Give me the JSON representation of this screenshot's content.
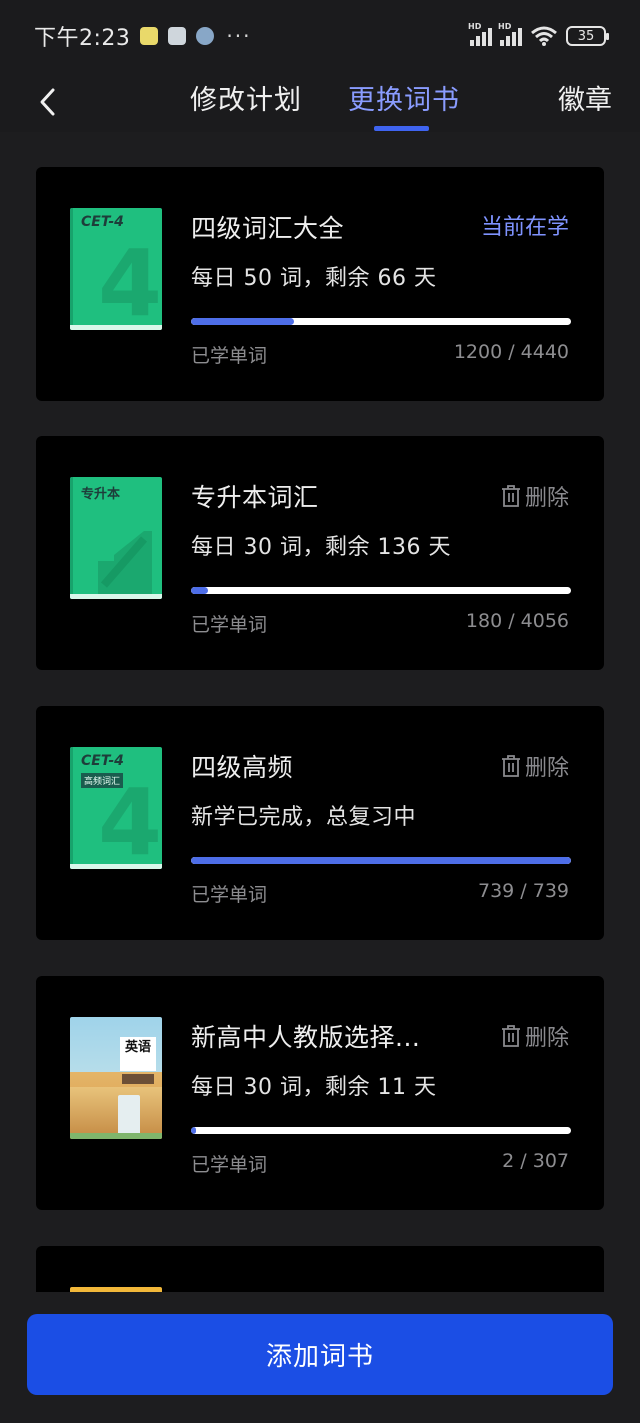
{
  "status_bar": {
    "time": "下午2:23",
    "overflow": "···",
    "signal_1_label": "HD",
    "signal_2_label": "HD",
    "battery": "35",
    "app_icons": [
      "notification-icon",
      "app-icon",
      "app-icon"
    ]
  },
  "nav": {
    "tab_plan": "修改计划",
    "tab_books": "更换词书",
    "tab_badges": "徽章",
    "active_tab": "更换词书",
    "accent_color": "#3f64f0"
  },
  "books": [
    {
      "title": "四级词汇大全",
      "plan": "每日 50 词，剩余 66 天",
      "status": "当前在学",
      "learned_label": "已学单词",
      "learned": "1200 / 4440",
      "progress": 0.27,
      "cover_label": "CET-4",
      "cover_big": "4"
    },
    {
      "title": "专升本词汇",
      "plan": "每日 30 词，剩余 136 天",
      "action": "删除",
      "learned_label": "已学单词",
      "learned": "180 / 4056",
      "progress": 0.044,
      "cover_label": "专升本"
    },
    {
      "title": "四级高频",
      "plan": "新学已完成，总复习中",
      "action": "删除",
      "learned_label": "已学单词",
      "learned": "739 / 739",
      "progress": 1.0,
      "cover_label": "CET-4",
      "cover_sublabel": "高频词汇",
      "cover_big": "4"
    },
    {
      "title": "新高中人教版选择...",
      "plan": "每日 30 词，剩余 11 天",
      "action": "删除",
      "learned_label": "已学单词",
      "learned": "2 / 307",
      "progress": 0.0065,
      "cover_label": "英语"
    }
  ],
  "footer": {
    "add_button": "添加词书",
    "button_color": "#1b4ee5"
  }
}
